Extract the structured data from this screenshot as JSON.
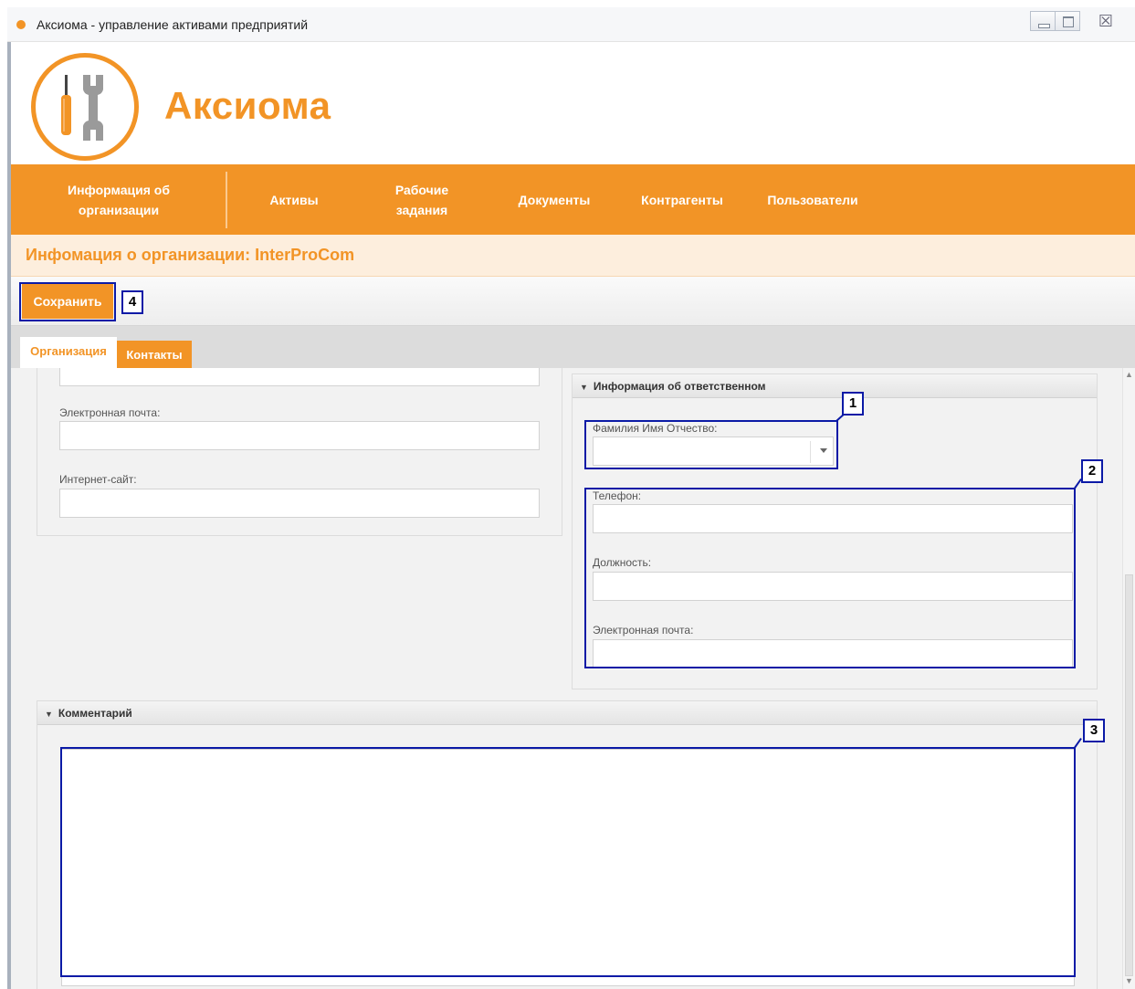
{
  "window": {
    "title": "Аксиома - управление активами предприятий",
    "close_glyph": "☒"
  },
  "header": {
    "brand": "Аксиома"
  },
  "nav": {
    "items": [
      {
        "label": "Информация об организации"
      },
      {
        "label": "Активы"
      },
      {
        "label": "Рабочие задания"
      },
      {
        "label": "Документы"
      },
      {
        "label": "Контрагенты"
      },
      {
        "label": "Пользователи"
      }
    ]
  },
  "page": {
    "title": "Инфомация о организации: InterProCom"
  },
  "toolbar": {
    "save_label": "Сохранить"
  },
  "tabs": [
    {
      "label": "Организация",
      "active": true
    },
    {
      "label": "Контакты",
      "active": false
    }
  ],
  "org_panel": {
    "email_label": "Электронная почта:",
    "email_value": "",
    "website_label": "Интернет-сайт:",
    "website_value": ""
  },
  "responsible_panel": {
    "header": "Информация об ответственном",
    "fio_label": "Фамилия Имя Отчество:",
    "fio_value": "",
    "phone_label": "Телефон:",
    "phone_value": "",
    "position_label": "Должность:",
    "position_value": "",
    "email_label": "Электронная почта:",
    "email_value": ""
  },
  "comment_panel": {
    "header": "Комментарий",
    "value": ""
  },
  "annotations": [
    "1",
    "2",
    "3",
    "4"
  ],
  "colors": {
    "accent": "#f29426",
    "accent_light": "#fdeedd",
    "annotation": "#0b1aa6"
  },
  "icons": {
    "logo": "tools-wrench-screwdriver-icon",
    "collapse": "triangle-down-icon",
    "dropdown": "chevron-down-icon"
  }
}
